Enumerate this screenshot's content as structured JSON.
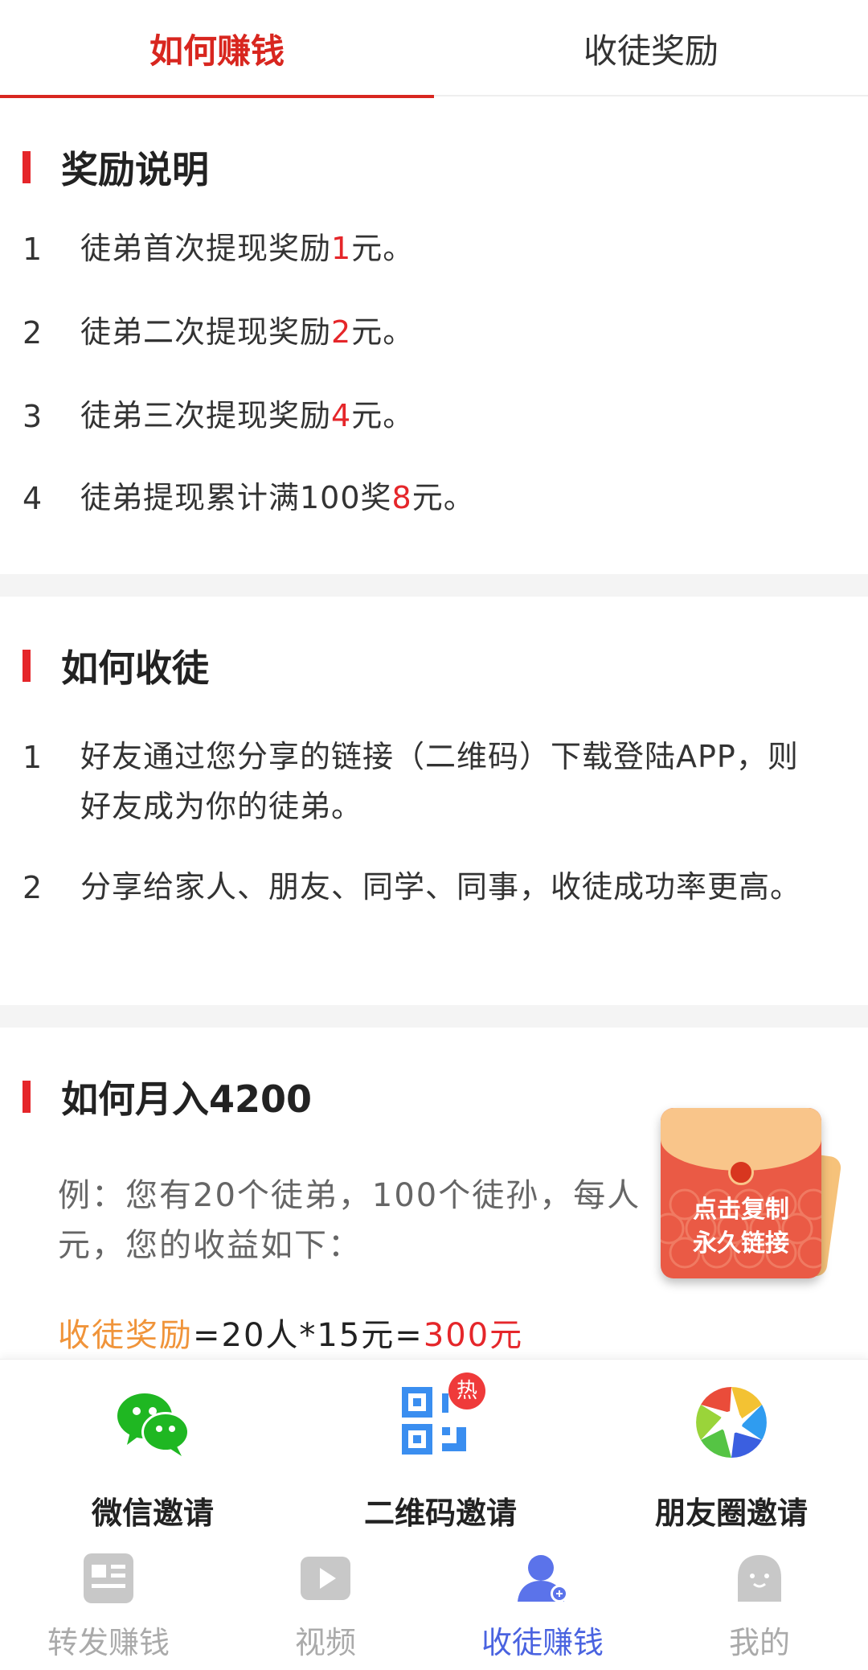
{
  "tabs": [
    {
      "label": "如何赚钱",
      "active": true
    },
    {
      "label": "收徒奖励",
      "active": false
    }
  ],
  "reward_section": {
    "title": "奖励说明",
    "items": [
      {
        "num": "1",
        "before": "徒弟首次提现奖励",
        "amount": "1",
        "after": "元。"
      },
      {
        "num": "2",
        "before": "徒弟二次提现奖励",
        "amount": "2",
        "after": "元。"
      },
      {
        "num": "3",
        "before": "徒弟三次提现奖励",
        "amount": "4",
        "after": "元。"
      },
      {
        "num": "4",
        "before": "徒弟提现累计满100奖",
        "amount": "8",
        "after": "元。"
      }
    ]
  },
  "recruit_section": {
    "title": "如何收徒",
    "items": [
      {
        "num": "1",
        "text": "好友通过您分享的链接（二维码）下载登陆APP，则好友成为你的徒弟。"
      },
      {
        "num": "2",
        "text": "分享给家人、朋友、同学、同事，收徒成功率更高。"
      }
    ]
  },
  "income_section": {
    "title": "如何月入4200",
    "example": "例：您有20个徒弟，100个徒孙，每人",
    "example_line2": "元，您的收益如下：",
    "formula_label": "收徒奖励",
    "formula_expr": "=20人*15元=",
    "formula_result": "300元"
  },
  "envelope": {
    "line1": "点击复制",
    "line2": "永久链接"
  },
  "invite": [
    {
      "label": "微信邀请",
      "icon": "wechat-icon"
    },
    {
      "label": "二维码邀请",
      "icon": "qrcode-icon",
      "badge": "热"
    },
    {
      "label": "朋友圈邀请",
      "icon": "moments-icon"
    }
  ],
  "nav": [
    {
      "label": "转发赚钱",
      "icon": "article-icon",
      "active": false
    },
    {
      "label": "视频",
      "icon": "video-icon",
      "active": false
    },
    {
      "label": "收徒赚钱",
      "icon": "user-add-icon",
      "active": true
    },
    {
      "label": "我的",
      "icon": "profile-icon",
      "active": false
    }
  ],
  "colors": {
    "accent_red": "#e5262a",
    "nav_active": "#4a63e0",
    "orange": "#f0943a"
  }
}
